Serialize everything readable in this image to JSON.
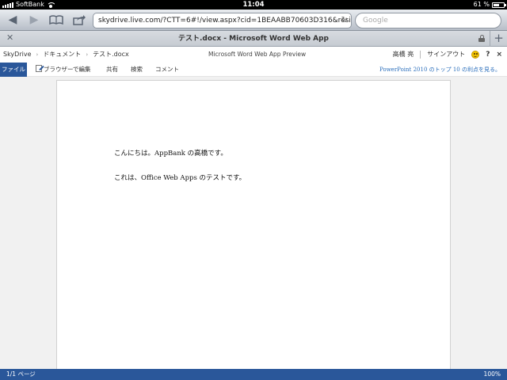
{
  "status_bar": {
    "carrier": "SoftBank",
    "time": "11:04",
    "battery": "61 %",
    "battery_level": 0.61
  },
  "browser": {
    "url": "skydrive.live.com/?CTT=6#!/view.aspx?cid=1BEAABB70603D316&resid=",
    "search_placeholder": "Google",
    "tab_title": "テスト.docx - Microsoft Word Web App"
  },
  "app_header": {
    "breadcrumb": [
      "SkyDrive",
      "ドキュメント",
      "テスト.docx"
    ],
    "app_title": "Microsoft Word Web App Preview",
    "user_name": "高橋 亮",
    "sign_out": "サインアウト",
    "help": "?",
    "close": "×"
  },
  "ribbon": {
    "file_tab": "ファイル",
    "edit_in_browser": "ブラウザーで編集",
    "share": "共有",
    "search": "検索",
    "comment": "コメント",
    "promo_link": "PowerPoint 2010 のトップ 10 の利点を見る。"
  },
  "document": {
    "paragraphs": [
      "こんにちは。AppBank の高橋です。",
      "これは、Office Web Apps のテストです。"
    ]
  },
  "footer": {
    "page_indicator": "1/1 ページ",
    "zoom": "100%"
  }
}
